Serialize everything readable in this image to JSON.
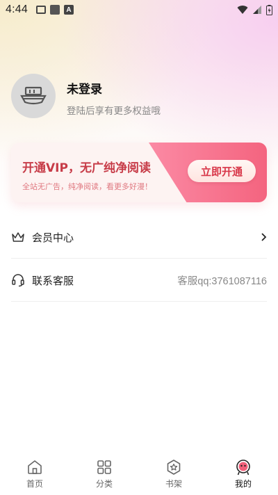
{
  "status_bar": {
    "time": "4:44",
    "notif_icons": [
      "image-icon",
      "app-square-icon",
      "a-letter-icon"
    ],
    "right_icons": [
      "wifi-icon",
      "signal-icon",
      "battery-icon"
    ]
  },
  "profile": {
    "avatar_icon": "boat-placeholder-icon",
    "title": "未登录",
    "subtitle": "登陆后享有更多权益哦"
  },
  "vip": {
    "title": "开通VIP，无广纯净阅读",
    "subtitle": "全站无广告，纯净阅读，看更多好漫！",
    "button": "立即开通",
    "colors": {
      "accent": "#f4647f",
      "title": "#c73c48"
    }
  },
  "menu": [
    {
      "icon": "crown-icon",
      "label": "会员中心",
      "right": "chevron-right-icon"
    },
    {
      "icon": "headset-icon",
      "label": "联系客服",
      "right_text": "客服qq:3761087116"
    }
  ],
  "tabs": [
    {
      "icon": "home-icon",
      "label": "首页",
      "active": false
    },
    {
      "icon": "grid-icon",
      "label": "分类",
      "active": false
    },
    {
      "icon": "bookshelf-icon",
      "label": "书架",
      "active": false
    },
    {
      "icon": "profile-icon",
      "label": "我的",
      "active": true
    }
  ]
}
